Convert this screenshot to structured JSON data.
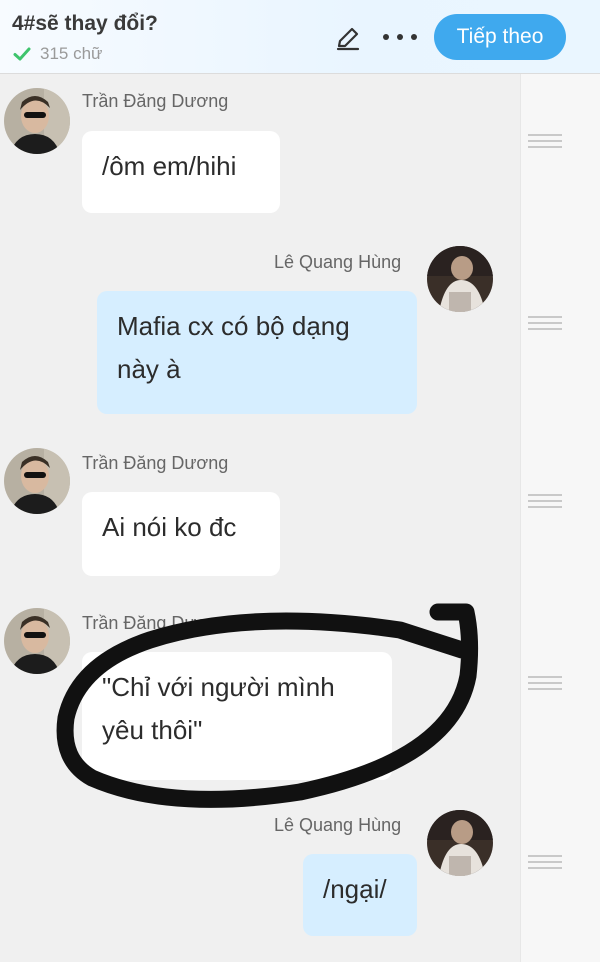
{
  "header": {
    "title": "4#sẽ thay đổi?",
    "word_count": "315 chữ",
    "next_label": "Tiếp theo"
  },
  "messages": [
    {
      "sender": "Trần Đăng Dương",
      "text": "/ôm em/hihi"
    },
    {
      "sender": "Lê Quang Hùng",
      "line1": "Mafia cx có bộ dạng",
      "line2": "này à"
    },
    {
      "sender": "Trần Đăng Dương",
      "text": "Ai nói ko đc"
    },
    {
      "sender": "Trần Đăng Dương",
      "line1": "\"Chỉ với người mình",
      "line2": "yêu thôi\""
    },
    {
      "sender": "Lê Quang Hùng",
      "text": "/ngại/"
    }
  ],
  "colors": {
    "accent": "#3fa9ee",
    "incoming_bubble": "#ffffff",
    "outgoing_bubble": "#d6eeff",
    "check": "#3ec46d",
    "annotation": "#111111"
  },
  "icons": [
    "check-icon",
    "pencil-icon",
    "more-icon",
    "drag-handle-icon"
  ]
}
